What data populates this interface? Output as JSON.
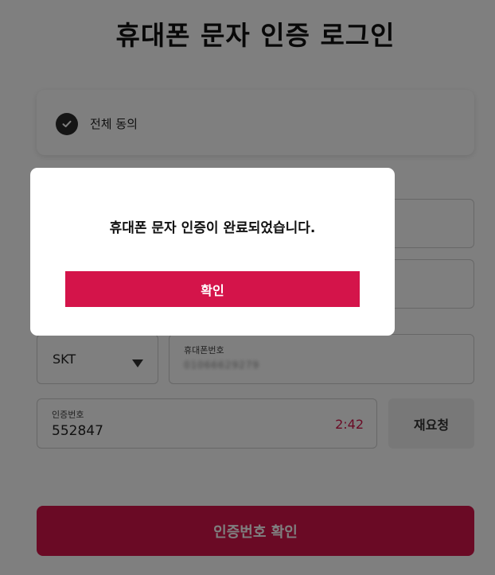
{
  "page": {
    "title": "휴대폰 문자 인증 로그인"
  },
  "agreement": {
    "all_agree_label": "전체 동의",
    "checked": true,
    "check_icon": "check-circle-icon"
  },
  "form": {
    "carrier": {
      "value": "SKT",
      "arrow_icon": "caret-down-icon"
    },
    "phone": {
      "label": "휴대폰번호",
      "value": "01066629279"
    },
    "code": {
      "label": "인증번호",
      "value": "552847",
      "timer": "2:42"
    },
    "resend_label": "재요청",
    "verify_label": "인증번호 확인"
  },
  "modal": {
    "message": "휴대폰 문자 인증이 완료되었습니다.",
    "confirm_label": "확인"
  },
  "colors": {
    "accent": "#d4144a",
    "overlay": "rgba(0,0,0,0.5)",
    "timer": "#d4144a"
  }
}
